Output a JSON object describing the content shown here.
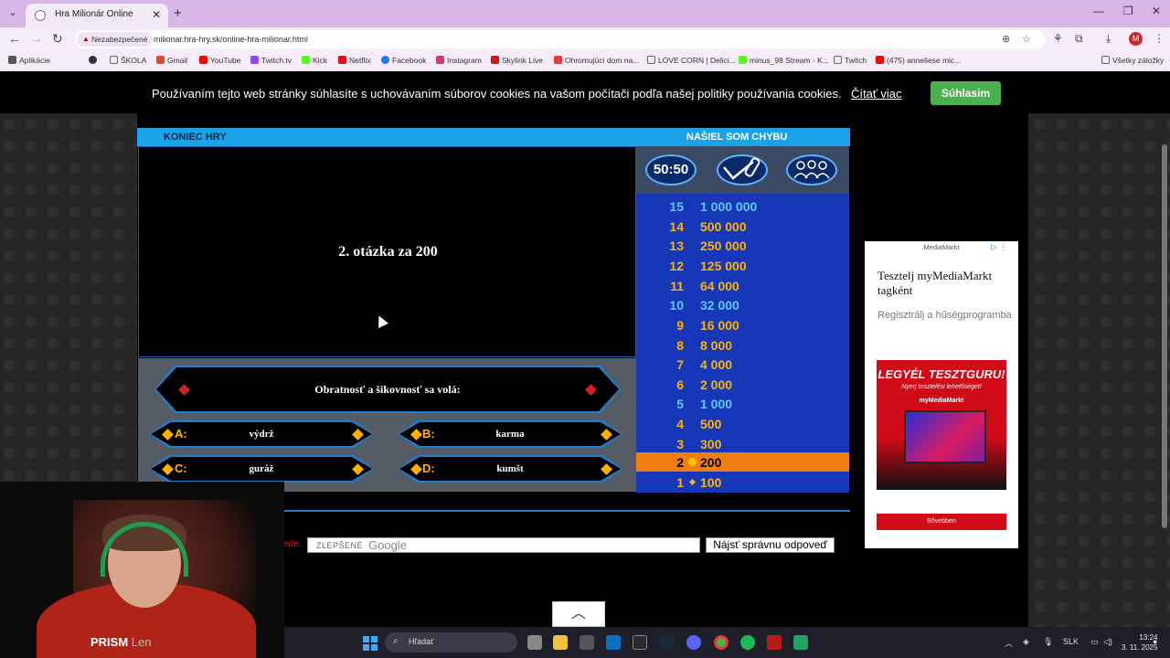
{
  "browser": {
    "tab_title": "Hra Milionár Online",
    "security_label": "Nezabezpečené",
    "url": "milionar.hra-hry.sk/online-hra-milionar.html",
    "bookmarks": [
      "Aplikácie",
      "ŠKOLA",
      "Gmail",
      "YouTube",
      "Twitch.tv",
      "Kick",
      "Netflix",
      "Facebook",
      "Instagram",
      "Skylink Live",
      "Ohromujúci dom na...",
      "LOVE CORN | Delici...",
      "minus_98 Stream - K...",
      "Twitch",
      "(475) anneliese mic..."
    ],
    "bookmarks_all": "Všetky záložky",
    "profile_initial": "M"
  },
  "cookie": {
    "text": "Používaním tejto web stránky súhlasíte s uchovávaním súborov cookies na vašom počítači podľa našej politiky používania cookies.",
    "link": "Čítať viac",
    "accept": "Súhlasim"
  },
  "game": {
    "end_game": "KONIEC HRY",
    "report_bug": "NAŠIEL SOM CHYBU",
    "question_header": "2. otázka za 200",
    "question": "Obratnosť a šikovnosť sa volá:",
    "answers": [
      {
        "letter": "A:",
        "text": "výdrž"
      },
      {
        "letter": "B:",
        "text": "karma"
      },
      {
        "letter": "C:",
        "text": "guráž"
      },
      {
        "letter": "D:",
        "text": "kumšt"
      }
    ],
    "lifelines": {
      "fifty": "50:50",
      "phone": "phone-a-friend",
      "audience": "ask-the-audience"
    },
    "ladder": [
      {
        "num": "15",
        "amount": "1 000 000"
      },
      {
        "num": "14",
        "amount": "500 000"
      },
      {
        "num": "13",
        "amount": "250 000"
      },
      {
        "num": "12",
        "amount": "125 000"
      },
      {
        "num": "11",
        "amount": "64 000"
      },
      {
        "num": "10",
        "amount": "32 000"
      },
      {
        "num": "9",
        "amount": "16 000"
      },
      {
        "num": "8",
        "amount": "8 000"
      },
      {
        "num": "7",
        "amount": "4 000"
      },
      {
        "num": "6",
        "amount": "2 000"
      },
      {
        "num": "5",
        "amount": "1 000"
      },
      {
        "num": "4",
        "amount": "500"
      },
      {
        "num": "3",
        "amount": "300"
      },
      {
        "num": "2",
        "amount": "200"
      },
      {
        "num": "1",
        "amount": "100"
      }
    ],
    "current_level": "2",
    "colors": {
      "current": "#f07e10",
      "ladder_bg": "#1637b8",
      "strip": "#1aa3e8"
    }
  },
  "search": {
    "label": "ede:",
    "brand_prefix": "ZLEPŠENÉ",
    "brand": "Google",
    "button": "Nájsť správnu odpoveď"
  },
  "ad": {
    "brand": "MediaMarkt",
    "title": "Tesztelj myMediaMarkt tagként",
    "subtitle": "Regisztrálj a hűségprogramba",
    "image_headline": "LEGYÉL TESZTGURU!",
    "image_sub": "Nyerj tesztelési lehetőséget!",
    "image_brand": "myMediaMarkt",
    "cta": "Bővebben"
  },
  "webcam": {
    "name": "PRISM",
    "name_suffix": "Len"
  },
  "taskbar": {
    "search": "Hľadať",
    "lang": "SLK",
    "time": "13:24",
    "date": "3. 11. 2025"
  }
}
